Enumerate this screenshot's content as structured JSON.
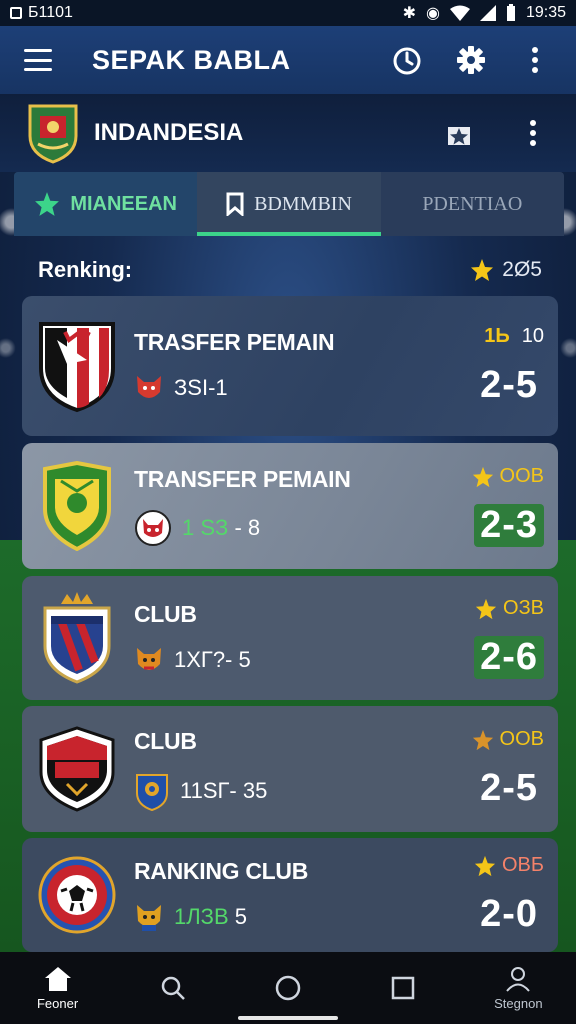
{
  "status_bar": {
    "left_text": "Б1101",
    "time": "19:35"
  },
  "app_bar": {
    "title": "SEPAK BABLA"
  },
  "team": {
    "name": "INDANDESIA"
  },
  "tabs": [
    {
      "label": "MIANEEAN"
    },
    {
      "label": "BDMMBIN"
    },
    {
      "label": "PDENTIAO"
    }
  ],
  "ranking": {
    "label": "Renking:",
    "year": "2Ø5"
  },
  "cards": [
    {
      "title": "TRASFER PEMAIN",
      "subline": "ЗЅІ-1",
      "badge": "1Ь",
      "badge_number": "10",
      "score": "2-5"
    },
    {
      "title": "TRANSFER PEMAIN",
      "subline_a": "1 SЗ",
      "subline_b": "- 8",
      "badge": "OOB",
      "score": "2-3"
    },
    {
      "title": "CLUB",
      "subline": "1XГ?- 5",
      "badge": "ОЗВ",
      "score": "2-6"
    },
    {
      "title": "CLUB",
      "subline": "11SГ- 35",
      "badge": "ООВ",
      "score": "2-5"
    },
    {
      "title": "RANKING CLUB",
      "subline_a": "1ЛЗВ",
      "subline_b": "5",
      "badge": "ОВБ",
      "score": "2-0"
    }
  ],
  "bottom_nav": {
    "home_label": "Feoner",
    "profile_label": "Stegnon"
  },
  "colors": {
    "accent_green": "#3cd48a",
    "star": "#f4c518",
    "score_green": "#2f7d3c",
    "appbar": "#1d3f77"
  }
}
